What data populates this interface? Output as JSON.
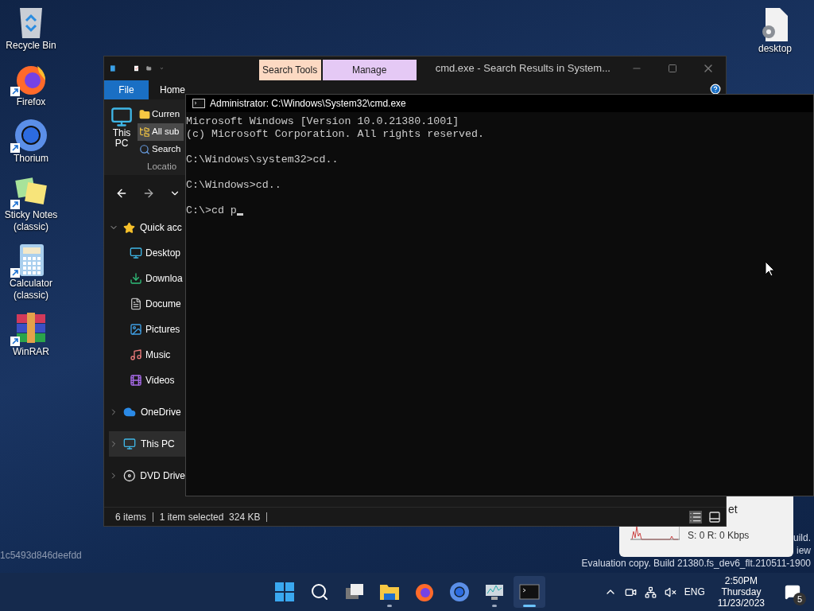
{
  "desktop_icons": [
    {
      "label": "Recycle Bin",
      "shortcut": false
    },
    {
      "label": "Firefox",
      "shortcut": true
    },
    {
      "label": "Thorium",
      "shortcut": true
    },
    {
      "label": "Sticky Notes (classic)",
      "shortcut": true
    },
    {
      "label": "Calculator (classic)",
      "shortcut": true
    },
    {
      "label": "WinRAR",
      "shortcut": true
    }
  ],
  "desktop_file": {
    "label": "desktop"
  },
  "device_id": "1c5493d846deefdd",
  "watermark": [
    "uild.",
    "iew",
    "Evaluation copy. Build 21380.fs_dev6_flt.210511-1900"
  ],
  "network_widget": {
    "title": "et",
    "reading": "S: 0 R: 0 Kbps"
  },
  "explorer": {
    "context_tabs": [
      {
        "label": "Search Tools",
        "color": "#fcd9c2"
      },
      {
        "label": "Manage",
        "color": "#e5c9f5"
      }
    ],
    "title": "cmd.exe - Search Results in System...",
    "ribbon_tabs": [
      {
        "label": "File",
        "kind": "file"
      },
      {
        "label": "Home",
        "kind": "tab"
      }
    ],
    "ribbon": {
      "big_button": "This PC",
      "items": [
        {
          "label": "Curren",
          "selected": false
        },
        {
          "label": "All sub",
          "selected": true
        },
        {
          "label": "Search",
          "selected": false
        }
      ],
      "group": "Locatio"
    },
    "nav_tree": [
      {
        "label": "Quick acc",
        "expanded": true,
        "selected": false,
        "children": [
          {
            "label": "Desktop"
          },
          {
            "label": "Downloa"
          },
          {
            "label": "Docume"
          },
          {
            "label": "Pictures"
          },
          {
            "label": "Music"
          },
          {
            "label": "Videos"
          }
        ]
      },
      {
        "label": "OneDrive",
        "expanded": false,
        "selected": false
      },
      {
        "label": "This PC",
        "expanded": false,
        "selected": true
      },
      {
        "label": "DVD Drive",
        "expanded": false,
        "selected": false
      }
    ],
    "status_bar": {
      "items": "6 items",
      "selection": "1 item selected  324 KB"
    }
  },
  "cmd": {
    "title": "Administrator: C:\\Windows\\System32\\cmd.exe",
    "blocks": [
      [
        "Microsoft Windows [Version 10.0.21380.1001]",
        "(c) Microsoft Corporation. All rights reserved."
      ],
      [
        "C:\\Windows\\system32>cd.."
      ],
      [
        "C:\\Windows>cd.."
      ],
      [
        "C:\\>cd p"
      ]
    ]
  },
  "taskbar": {
    "apps": [
      {
        "running": false,
        "selected": false
      },
      {
        "running": false,
        "selected": false
      },
      {
        "running": false,
        "selected": false
      },
      {
        "running": true,
        "selected": false
      },
      {
        "running": false,
        "selected": false
      },
      {
        "running": false,
        "selected": false
      },
      {
        "running": true,
        "selected": false
      },
      {
        "running": true,
        "selected": true
      }
    ],
    "language": "ENG",
    "time": "2:50PM",
    "day": "Thursday",
    "date": "11/23/2023",
    "notifications": "5"
  }
}
